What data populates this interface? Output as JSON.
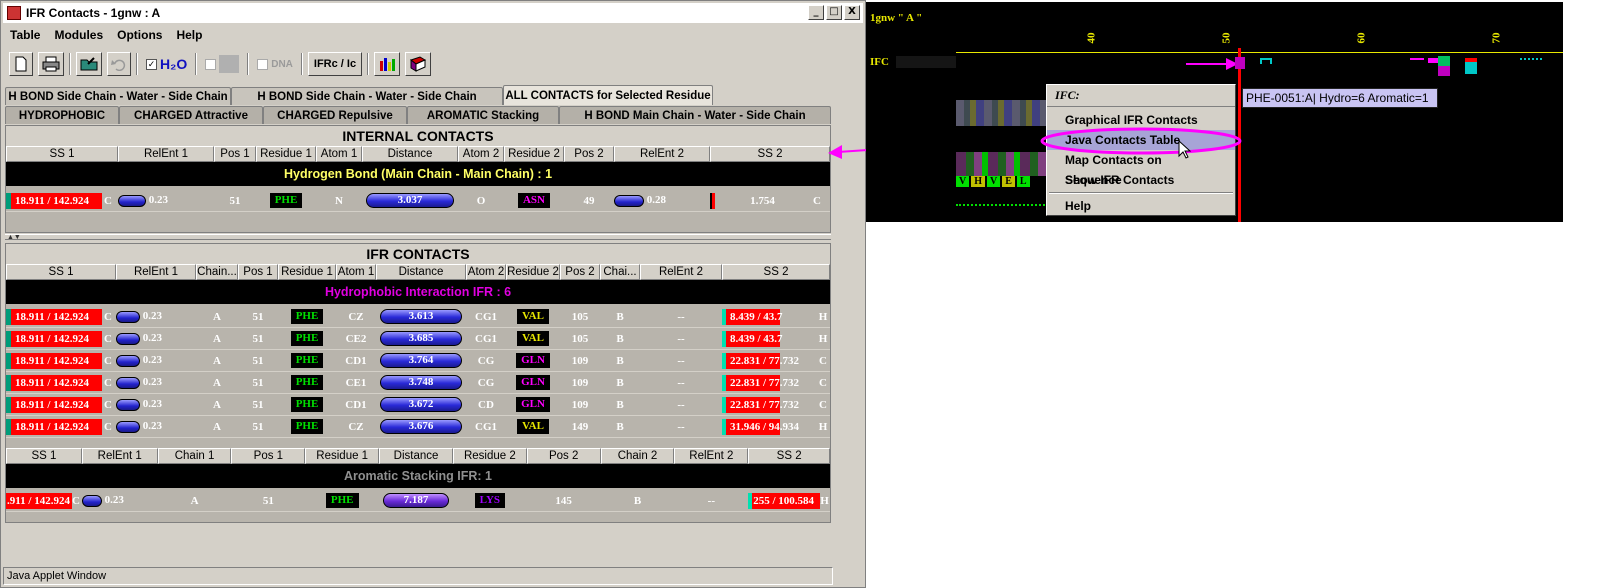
{
  "window": {
    "title": "IFR Contacts - 1gnw : A",
    "controls": [
      "_",
      "□",
      "X"
    ]
  },
  "menu": [
    "Table",
    "Modules",
    "Options",
    "Help"
  ],
  "toolbar": {
    "h2o_label": "H₂O",
    "dna_label": "DNA",
    "ifrc_label": "IFRc / Ic"
  },
  "tabs_row1": [
    "H BOND Side Chain - Water - Side Chain",
    "H BOND Side Chain - Water - Side Chain",
    "ALL CONTACTS for Selected Residue"
  ],
  "tabs_row2": [
    "HYDROPHOBIC",
    "CHARGED Attractive",
    "CHARGED Repulsive",
    "AROMATIC Stacking",
    "H BOND Main Chain - Water - Side Chain"
  ],
  "internal": {
    "title": "INTERNAL CONTACTS",
    "headers": [
      "SS 1",
      "RelEnt 1",
      "Pos 1",
      "Residue 1",
      "Atom 1",
      "Distance",
      "Atom 2",
      "Residue 2",
      "Pos 2",
      "RelEnt 2",
      "SS 2"
    ],
    "section": "Hydrogen Bond (Main Chain - Main Chain) :  1",
    "rows": [
      {
        "ss1": "18.911 / 142.924",
        "ss1t": "C",
        "rel1": "0.23",
        "pos1": "51",
        "res1": "PHE",
        "atom1": "N",
        "dist": "3.037",
        "atom2": "O",
        "res2": "ASN",
        "pos2": "49",
        "rel2": "0.28",
        "ss2": "1.754",
        "ss2t": "C"
      }
    ]
  },
  "ifr": {
    "title": "IFR CONTACTS",
    "headers": [
      "SS 1",
      "RelEnt 1",
      "Chain...",
      "Pos 1",
      "Residue 1",
      "Atom 1",
      "Distance",
      "Atom 2",
      "Residue 2",
      "Pos 2",
      "Chai...",
      "RelEnt 2",
      "SS 2"
    ],
    "section": "Hydrophobic Interaction IFR :  6",
    "rows": [
      {
        "ss1": "18.911 / 142.924",
        "ss1t": "C",
        "rel1": "0.23",
        "ch1": "A",
        "pos1": "51",
        "res1": "PHE",
        "atom1": "CZ",
        "dist": "3.613",
        "atom2": "CG1",
        "res2": "VAL",
        "pos2": "105",
        "ch2": "B",
        "rel2": "--",
        "ss2": "8.439 / 43.7",
        "ss2t": "H"
      },
      {
        "ss1": "18.911 / 142.924",
        "ss1t": "C",
        "rel1": "0.23",
        "ch1": "A",
        "pos1": "51",
        "res1": "PHE",
        "atom1": "CE2",
        "dist": "3.685",
        "atom2": "CG1",
        "res2": "VAL",
        "pos2": "105",
        "ch2": "B",
        "rel2": "--",
        "ss2": "8.439 / 43.7",
        "ss2t": "H"
      },
      {
        "ss1": "18.911 / 142.924",
        "ss1t": "C",
        "rel1": "0.23",
        "ch1": "A",
        "pos1": "51",
        "res1": "PHE",
        "atom1": "CD1",
        "dist": "3.764",
        "atom2": "CG",
        "res2": "GLN",
        "pos2": "109",
        "ch2": "B",
        "rel2": "--",
        "ss2": "22.831 / 77.732",
        "ss2t": "C"
      },
      {
        "ss1": "18.911 / 142.924",
        "ss1t": "C",
        "rel1": "0.23",
        "ch1": "A",
        "pos1": "51",
        "res1": "PHE",
        "atom1": "CE1",
        "dist": "3.748",
        "atom2": "CG",
        "res2": "GLN",
        "pos2": "109",
        "ch2": "B",
        "rel2": "--",
        "ss2": "22.831 / 77.732",
        "ss2t": "C"
      },
      {
        "ss1": "18.911 / 142.924",
        "ss1t": "C",
        "rel1": "0.23",
        "ch1": "A",
        "pos1": "51",
        "res1": "PHE",
        "atom1": "CD1",
        "dist": "3.672",
        "atom2": "CD",
        "res2": "GLN",
        "pos2": "109",
        "ch2": "B",
        "rel2": "--",
        "ss2": "22.831 / 77.732",
        "ss2t": "C"
      },
      {
        "ss1": "18.911 / 142.924",
        "ss1t": "C",
        "rel1": "0.23",
        "ch1": "A",
        "pos1": "51",
        "res1": "PHE",
        "atom1": "CZ",
        "dist": "3.676",
        "atom2": "CG1",
        "res2": "VAL",
        "pos2": "149",
        "ch2": "B",
        "rel2": "--",
        "ss2": "31.946 / 94.934",
        "ss2t": "H"
      }
    ]
  },
  "aromatic": {
    "headers": [
      "SS 1",
      "RelEnt 1",
      "Chain 1",
      "Pos 1",
      "Residue 1",
      "Distance",
      "Residue 2",
      "Pos 2",
      "Chain 2",
      "RelEnt 2",
      "SS 2"
    ],
    "section": "Aromatic Stacking IFR:  1",
    "rows": [
      {
        "ss1": ".911 / 142.924",
        "ss1t": "C",
        "rel1": "0.23",
        "ch1": "A",
        "pos1": "51",
        "res1": "PHE",
        "dist": "7.187",
        "res2": "LYS",
        "pos2": "145",
        "ch2": "B",
        "rel2": "--",
        "ss2": "255 / 100.584",
        "ss2t": "H"
      }
    ]
  },
  "statusbar": "Java Applet Window",
  "viewer": {
    "chain_label": "1gnw \" A \"",
    "track_label": "IFC",
    "ticks": [
      "40",
      "50",
      "60",
      "70"
    ],
    "residues": [
      "V",
      "H",
      "V",
      "E",
      "L"
    ],
    "popup_title": "IFC:",
    "popup_items": [
      "Graphical IFR Contacts",
      "Java Contacts Table",
      "Map Contacts on Sequence",
      "Show IFR Contacts",
      "Help"
    ],
    "tooltip": "PHE-0051:A| Hydro=6  Aromatic=1"
  },
  "colors": {
    "section_internal": "#ffff66",
    "section_hydrophobic": "#e000e0",
    "section_aromatic": "#909090",
    "phe": "#00e000",
    "val": "#e8e800",
    "gln": "#ff00ff",
    "lys": "#a000ff",
    "annotation": "#ff00ff"
  }
}
